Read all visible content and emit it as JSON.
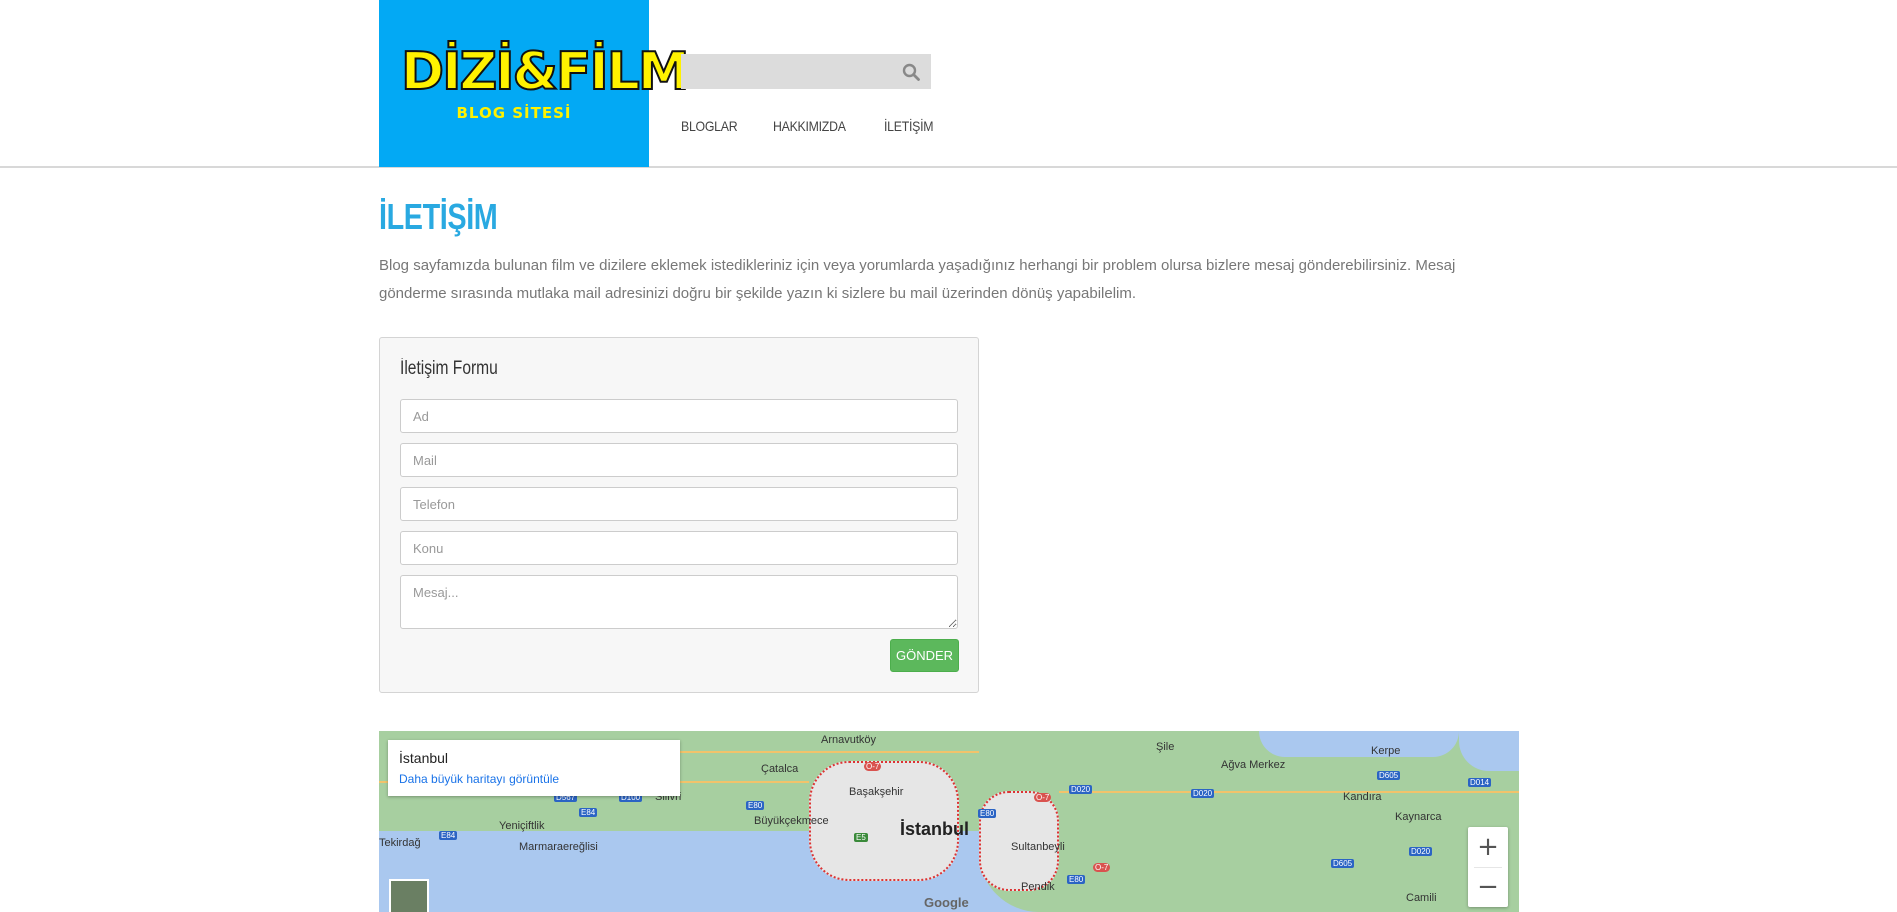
{
  "logo": {
    "main": "DİZİ&FİLM",
    "sub": "BLOG SİTESİ",
    "bg": "#03a9f4",
    "text_color": "#fff200"
  },
  "search": {
    "placeholder": "",
    "icon": "search-icon"
  },
  "nav": {
    "items": [
      {
        "label": "BLOGLAR"
      },
      {
        "label": "HAKKIMIZDA"
      },
      {
        "label": "İLETİŞİM"
      }
    ]
  },
  "page": {
    "title": "İLETİŞİM",
    "title_color": "#29a9e1",
    "intro": "Blog sayfamızda bulunan film ve dizilere eklemek istedikleriniz için veya yorumlarda yaşadığınız herhangi bir problem olursa bizlere mesaj gönderebilirsiniz. Mesaj gönderme sırasında mutlaka mail adresinizi doğru bir şekilde yazın ki sizlere bu mail üzerinden dönüş yapabilelim."
  },
  "form": {
    "title": "İletişim Formu",
    "fields": {
      "name_placeholder": "Ad",
      "mail_placeholder": "Mail",
      "phone_placeholder": "Telefon",
      "subject_placeholder": "Konu",
      "message_placeholder": "Mesaj..."
    },
    "submit_label": "GÖNDER",
    "submit_color": "#5cb85c"
  },
  "map": {
    "place": "İstanbul",
    "larger_map_link": "Daha büyük haritayı görüntüle",
    "zoom_in": "+",
    "zoom_out": "−",
    "attribution": "Google",
    "labels": {
      "arnavutkoy": "Arnavutköy",
      "sile": "Şile",
      "agva": "Ağva Merkez",
      "kerpe": "Kerpe",
      "catalca": "Çatalca",
      "basaksehir": "Başakşehir",
      "silivri": "Silivri",
      "buyukcekmece": "Büyükçekmece",
      "istanbul": "İstanbul",
      "kandira": "Kandıra",
      "kaynarca": "Kaynarca",
      "tekirdag": "Tekirdağ",
      "yeniciftlik": "Yeniçiftlik",
      "marmaraereglisi": "Marmaraereğlisi",
      "sultanbeyli": "Sultanbeyli",
      "pendik": "Pendik",
      "camili": "Camili"
    },
    "shields": {
      "e80a": "E80",
      "e80b": "E80",
      "e80c": "E80",
      "e84a": "E84",
      "e84b": "E84",
      "d100": "D100",
      "d567": "D567",
      "d020a": "D020",
      "d020b": "D020",
      "d020c": "D020",
      "d605a": "D605",
      "d605b": "D605",
      "d014": "D014",
      "o7a": "O-7",
      "o7b": "O-7",
      "o7c": "O-7",
      "e5": "E5"
    }
  }
}
